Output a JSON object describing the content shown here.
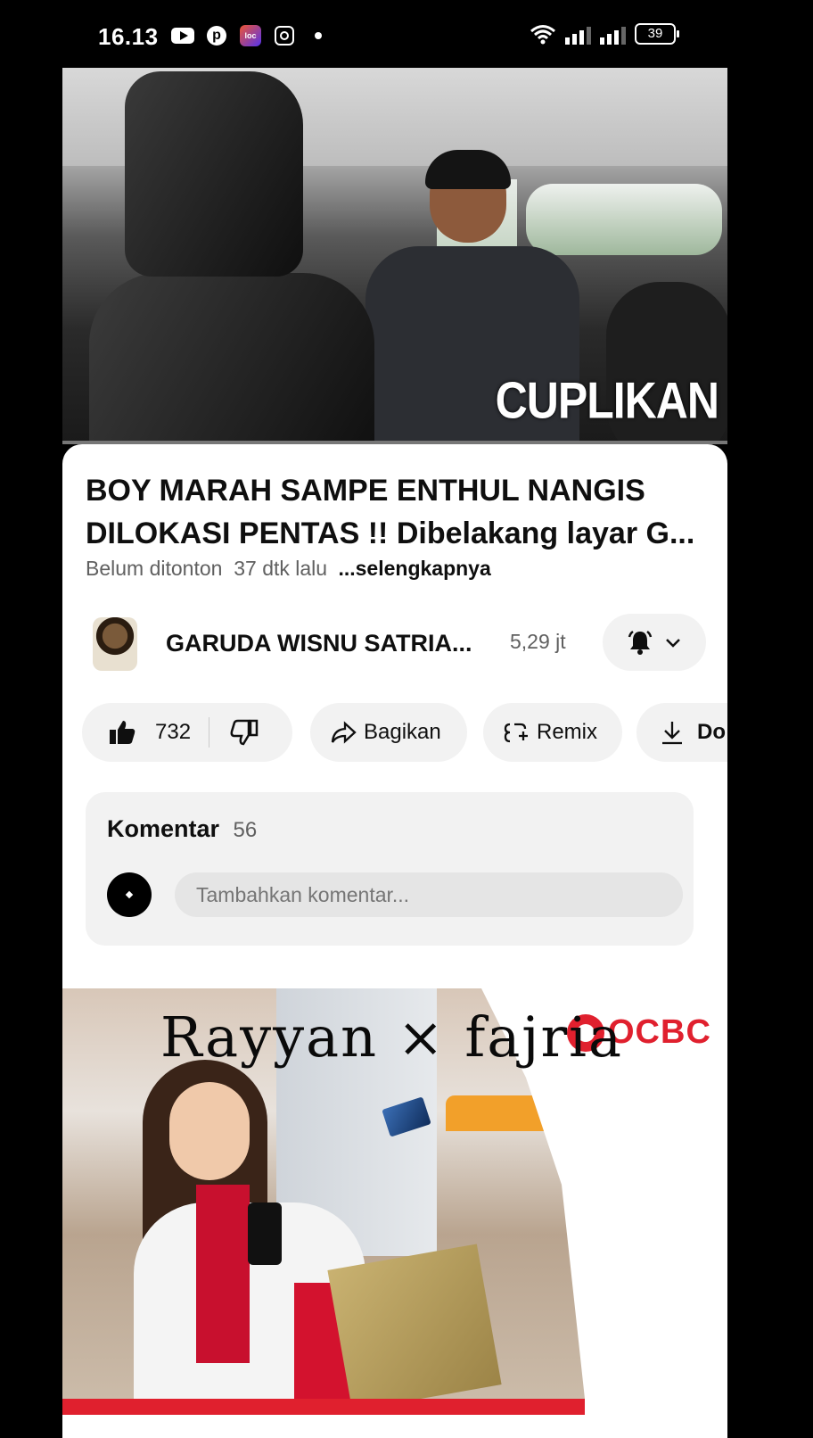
{
  "status_bar": {
    "time": "16.13",
    "battery": "39",
    "left_icons": [
      "youtube-icon",
      "pinterest-icon",
      "app-icon",
      "instagram-icon",
      "dot-icon"
    ],
    "right_icons": [
      "wifi-icon",
      "signal-icon",
      "signal-icon",
      "battery-icon"
    ]
  },
  "video": {
    "overlay_label": "CUPLIKAN",
    "progress": 0.0
  },
  "details": {
    "title": "BOY MARAH SAMPE ENTHUL NANGIS DILOKASI PENTAS !! Dibelakang layar G...",
    "views": "Belum ditonton",
    "age": "37 dtk lalu",
    "more": "...selengkapnya"
  },
  "channel": {
    "name": "GARUDA WISNU SATRIA...",
    "subscribers": "5,29 jt",
    "bell_icon": "bell-icon",
    "chevron_icon": "chevron-down-icon"
  },
  "actions": {
    "likes": "732",
    "share": "Bagikan",
    "remix": "Remix",
    "download": "Do"
  },
  "comments": {
    "heading": "Komentar",
    "count": "56",
    "placeholder": "Tambahkan komentar..."
  },
  "ad": {
    "overlay_text": "Rayyan × fajria",
    "brand": "OCBC",
    "brand_color": "#e0202e"
  },
  "colors": {
    "background": "#000000",
    "panel": "#ffffff",
    "pill": "#f2f2f2",
    "text_primary": "#0f0f0f",
    "text_secondary": "#606060"
  }
}
